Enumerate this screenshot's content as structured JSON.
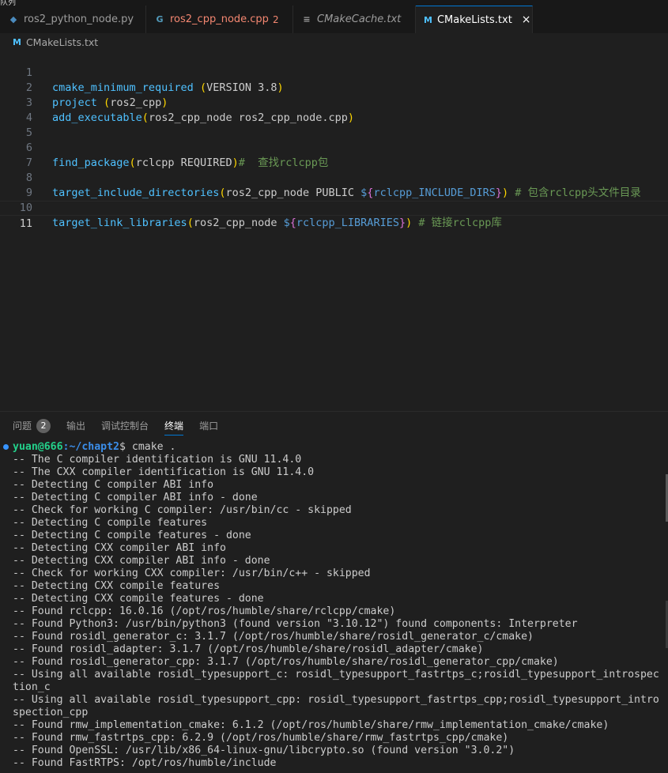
{
  "top_strip_text": "队列",
  "tabs": [
    {
      "label": "ros2_python_node.py",
      "icon": "python-icon",
      "glyph": "◆"
    },
    {
      "label": "ros2_cpp_node.cpp",
      "icon": "cpp-icon",
      "glyph": "G",
      "problems": "2"
    },
    {
      "label": "CMakeCache.txt",
      "icon": "text-file-icon",
      "glyph": "≡"
    },
    {
      "label": "CMakeLists.txt",
      "icon": "cmake-icon",
      "glyph": "M",
      "close": "×"
    }
  ],
  "breadcrumb": {
    "icon_glyph": "M",
    "file": "CMakeLists.txt"
  },
  "editor": {
    "line_numbers": [
      "1",
      "2",
      "3",
      "4",
      "5",
      "6",
      "7",
      "8",
      "9",
      "10",
      "11"
    ],
    "l1": {
      "fn": "cmake_minimum_required",
      "sp": " ",
      "open": "(",
      "args": "VERSION 3.8",
      "close": ")"
    },
    "l2": {
      "fn": "project",
      "sp": " ",
      "open": "(",
      "args": "ros2_cpp",
      "close": ")"
    },
    "l3": {
      "fn": "add_executable",
      "open": "(",
      "args": "ros2_cpp_node ros2_cpp_node.cpp",
      "close": ")"
    },
    "l6": {
      "fn": "find_package",
      "open": "(",
      "args": "rclcpp REQUIRED",
      "close": ")",
      "comment": "#  查找rclcpp包"
    },
    "l8": {
      "fn": "target_include_directories",
      "open": "(",
      "args": "ros2_cpp_node PUBLIC ",
      "var_dollar": "$",
      "var_open": "{",
      "var_name": "rclcpp_INCLUDE_DIRS",
      "var_close": "}",
      "close": ")",
      "comment": " # 包含rclcpp头文件目录"
    },
    "l10": {
      "fn": "target_link_libraries",
      "open": "(",
      "args": "ros2_cpp_node ",
      "var_dollar": "$",
      "var_open": "{",
      "var_name": "rclcpp_LIBRARIES",
      "var_close": "}",
      "close": ")",
      "comment": " # 链接rclcpp库"
    }
  },
  "panel": {
    "tabs": [
      "问题",
      "输出",
      "调试控制台",
      "终端",
      "端口"
    ],
    "problems_count": "2",
    "active_tab": "终端"
  },
  "terminal": {
    "prompt_user": "yuan@666",
    "prompt_path": ":~/chapt2",
    "prompt_cmd": "$ cmake .",
    "lines": [
      "-- The C compiler identification is GNU 11.4.0",
      "-- The CXX compiler identification is GNU 11.4.0",
      "-- Detecting C compiler ABI info",
      "-- Detecting C compiler ABI info - done",
      "-- Check for working C compiler: /usr/bin/cc - skipped",
      "-- Detecting C compile features",
      "-- Detecting C compile features - done",
      "-- Detecting CXX compiler ABI info",
      "-- Detecting CXX compiler ABI info - done",
      "-- Check for working CXX compiler: /usr/bin/c++ - skipped",
      "-- Detecting CXX compile features",
      "-- Detecting CXX compile features - done",
      "-- Found rclcpp: 16.0.16 (/opt/ros/humble/share/rclcpp/cmake)",
      "-- Found Python3: /usr/bin/python3 (found version \"3.10.12\") found components: Interpreter",
      "-- Found rosidl_generator_c: 3.1.7 (/opt/ros/humble/share/rosidl_generator_c/cmake)",
      "-- Found rosidl_adapter: 3.1.7 (/opt/ros/humble/share/rosidl_adapter/cmake)",
      "-- Found rosidl_generator_cpp: 3.1.7 (/opt/ros/humble/share/rosidl_generator_cpp/cmake)",
      "-- Using all available rosidl_typesupport_c: rosidl_typesupport_fastrtps_c;rosidl_typesupport_introspec",
      "tion_c",
      "-- Using all available rosidl_typesupport_cpp: rosidl_typesupport_fastrtps_cpp;rosidl_typesupport_intro",
      "spection_cpp",
      "-- Found rmw_implementation_cmake: 6.1.2 (/opt/ros/humble/share/rmw_implementation_cmake/cmake)",
      "-- Found rmw_fastrtps_cpp: 6.2.9 (/opt/ros/humble/share/rmw_fastrtps_cpp/cmake)",
      "-- Found OpenSSL: /usr/lib/x86_64-linux-gnu/libcrypto.so (found version \"3.0.2\")",
      "-- Found FastRTPS: /opt/ros/humble/include"
    ]
  }
}
